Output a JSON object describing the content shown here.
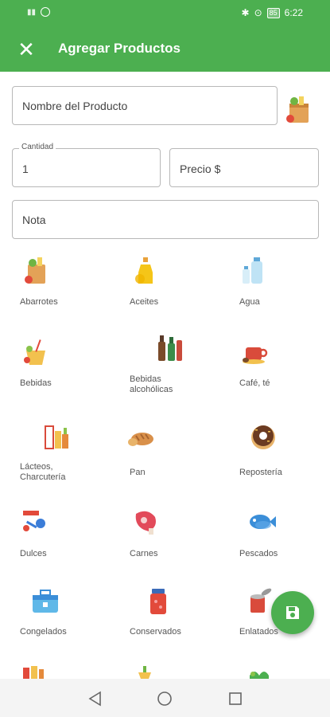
{
  "status": {
    "left_icons": "sim-icon",
    "time": "6:22",
    "battery": "85"
  },
  "header": {
    "title": "Agregar Productos",
    "close_icon": "close-icon"
  },
  "form": {
    "name_placeholder": "Nombre del Producto",
    "quantity_label": "Cantidad",
    "quantity_value": "1",
    "price_placeholder": "Precio $",
    "note_placeholder": "Nota"
  },
  "categories": [
    {
      "label": "Abarrotes",
      "icon": "grocery-bag-icon"
    },
    {
      "label": "Aceites",
      "icon": "oil-bottle-icon"
    },
    {
      "label": "Agua",
      "icon": "water-bottle-icon"
    },
    {
      "label": "Bebidas",
      "icon": "drinks-icon"
    },
    {
      "label": "Bebidas alcohólicas",
      "icon": "alcohol-bottles-icon"
    },
    {
      "label": "Café, té",
      "icon": "coffee-cup-icon"
    },
    {
      "label": "Lácteos, Charcutería",
      "icon": "dairy-icon"
    },
    {
      "label": "Pan",
      "icon": "bread-icon"
    },
    {
      "label": "Repostería",
      "icon": "donut-icon"
    },
    {
      "label": "Dulces",
      "icon": "candy-icon"
    },
    {
      "label": "Carnes",
      "icon": "meat-icon"
    },
    {
      "label": "Pescados",
      "icon": "fish-icon"
    },
    {
      "label": "Congelados",
      "icon": "cooler-icon"
    },
    {
      "label": "Conservados",
      "icon": "jar-icon"
    },
    {
      "label": "Enlatados",
      "icon": "can-icon"
    }
  ],
  "fab": {
    "icon": "save-icon"
  },
  "nav": {
    "back": "back-icon",
    "home": "home-icon",
    "recent": "recents-icon"
  }
}
